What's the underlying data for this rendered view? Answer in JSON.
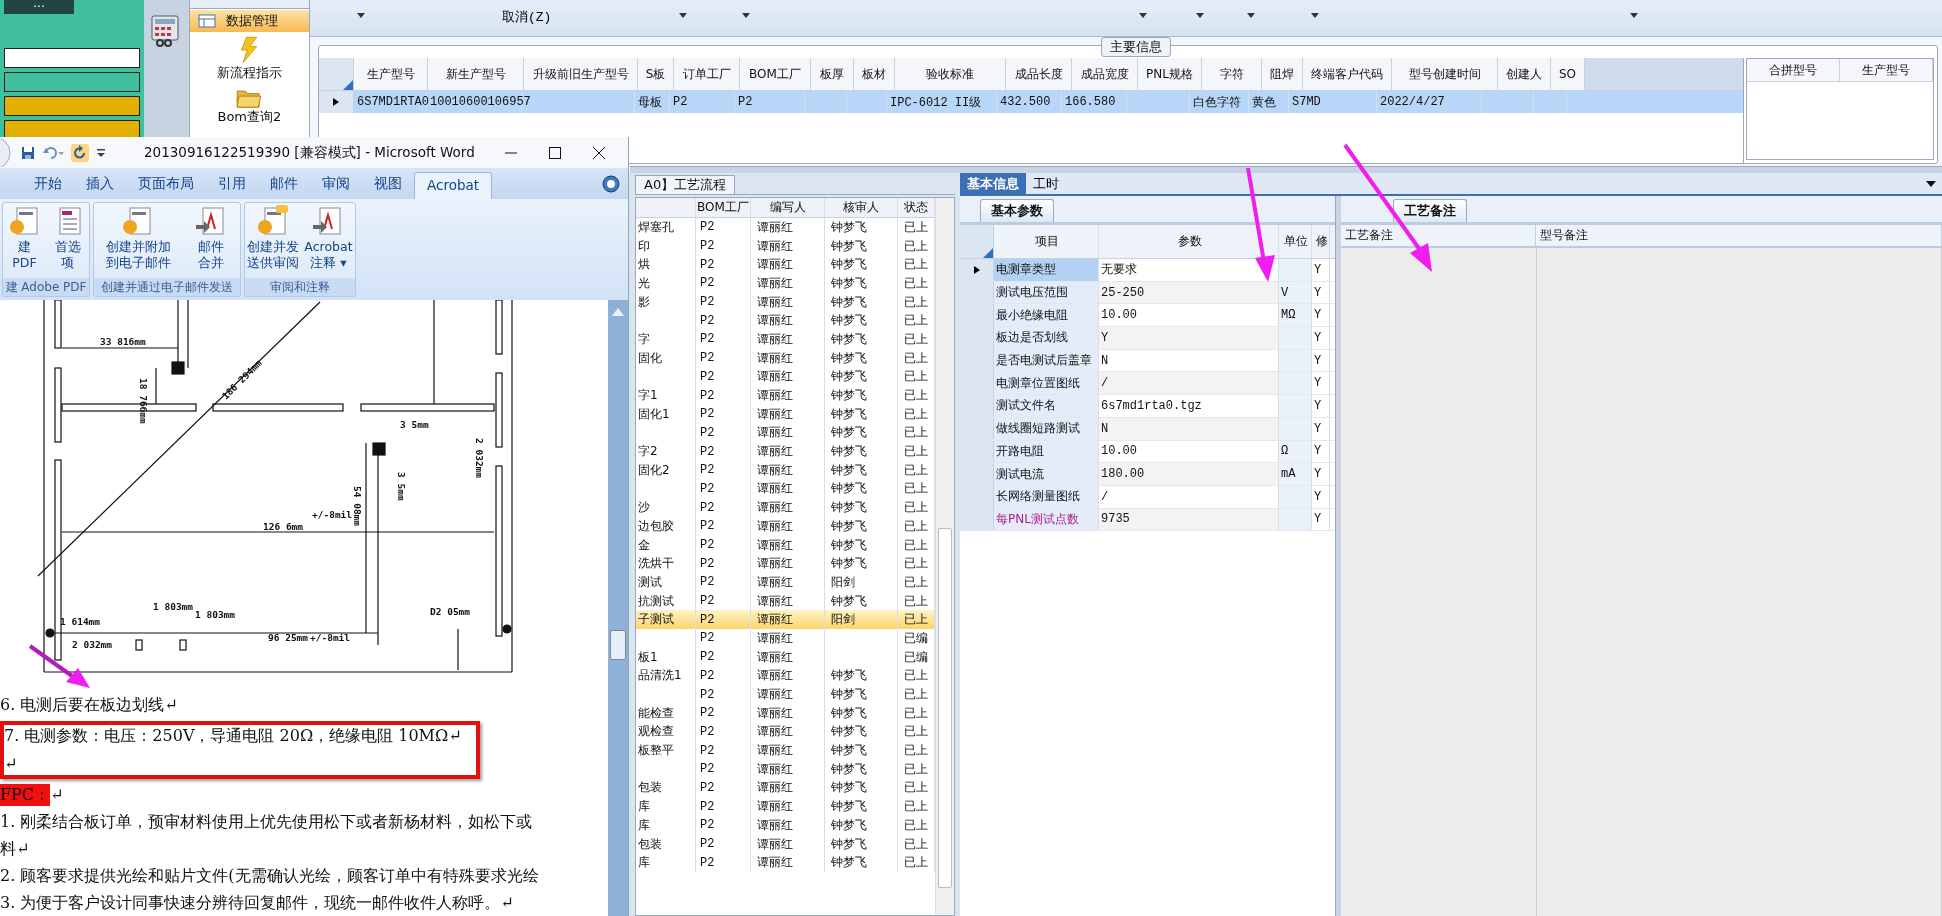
{
  "left_app": {
    "menu": "···"
  },
  "nav": {
    "items": [
      {
        "label": "数据管理",
        "selected": true
      },
      {
        "label": "新流程指示",
        "selected": false
      },
      {
        "label": "Bom查询2",
        "selected": false
      }
    ]
  },
  "toolbar": {
    "cancel": "取消(Z)"
  },
  "main_info": {
    "title": "主要信息",
    "columns": [
      "生产型号",
      "新生产型号",
      "升级前旧生产型号",
      "S板",
      "订单工厂",
      "BOM工厂",
      "板厚",
      "板材",
      "验收标准",
      "成品长度",
      "成品宽度",
      "PNL规格",
      "字符",
      "阻焊",
      "终端客户代码",
      "型号创建时间",
      "创建人",
      "SO"
    ],
    "rows": [
      {
        "selected": true,
        "cells": [
          "6S7MD1RTA0",
          "10010600106957",
          null,
          "母板",
          "P2",
          "P2",
          null,
          null,
          "IPC-6012 II级",
          "432.500",
          "166.580",
          null,
          "白色字符",
          "黄色",
          "S7MD",
          "2022/4/27",
          null,
          null
        ]
      }
    ]
  },
  "merge_grid": {
    "columns": [
      "合拼型号",
      "生产型号"
    ]
  },
  "process": {
    "tab": "A0】工艺流程",
    "columns": [
      "BOM工厂",
      "编写人",
      "核审人",
      "状态"
    ],
    "rows": [
      {
        "name": "焊塞孔",
        "factory": "P2",
        "writer": "谭丽红",
        "reviewer": "钟梦飞",
        "status": "已上",
        "selected": false
      },
      {
        "name": "印",
        "factory": "P2",
        "writer": "谭丽红",
        "reviewer": "钟梦飞",
        "status": "已上",
        "selected": false
      },
      {
        "name": "烘",
        "factory": "P2",
        "writer": "谭丽红",
        "reviewer": "钟梦飞",
        "status": "已上",
        "selected": false
      },
      {
        "name": "光",
        "factory": "P2",
        "writer": "谭丽红",
        "reviewer": "钟梦飞",
        "status": "已上",
        "selected": false
      },
      {
        "name": "影",
        "factory": "P2",
        "writer": "谭丽红",
        "reviewer": "钟梦飞",
        "status": "已上",
        "selected": false
      },
      {
        "factory": "P2",
        "writer": "谭丽红",
        "reviewer": "钟梦飞",
        "status": "已上",
        "selected": false
      },
      {
        "name": "字",
        "factory": "P2",
        "writer": "谭丽红",
        "reviewer": "钟梦飞",
        "status": "已上",
        "selected": false
      },
      {
        "name": "固化",
        "factory": "P2",
        "writer": "谭丽红",
        "reviewer": "钟梦飞",
        "status": "已上",
        "selected": false
      },
      {
        "factory": "P2",
        "writer": "谭丽红",
        "reviewer": "钟梦飞",
        "status": "已上",
        "selected": false
      },
      {
        "name": "字1",
        "factory": "P2",
        "writer": "谭丽红",
        "reviewer": "钟梦飞",
        "status": "已上",
        "selected": false
      },
      {
        "name": "固化1",
        "factory": "P2",
        "writer": "谭丽红",
        "reviewer": "钟梦飞",
        "status": "已上",
        "selected": false
      },
      {
        "factory": "P2",
        "writer": "谭丽红",
        "reviewer": "钟梦飞",
        "status": "已上",
        "selected": false
      },
      {
        "name": "字2",
        "factory": "P2",
        "writer": "谭丽红",
        "reviewer": "钟梦飞",
        "status": "已上",
        "selected": false
      },
      {
        "name": "固化2",
        "factory": "P2",
        "writer": "谭丽红",
        "reviewer": "钟梦飞",
        "status": "已上",
        "selected": false
      },
      {
        "factory": "P2",
        "writer": "谭丽红",
        "reviewer": "钟梦飞",
        "status": "已上",
        "selected": false
      },
      {
        "name": "沙",
        "factory": "P2",
        "writer": "谭丽红",
        "reviewer": "钟梦飞",
        "status": "已上",
        "selected": false
      },
      {
        "name": "边包胶",
        "factory": "P2",
        "writer": "谭丽红",
        "reviewer": "钟梦飞",
        "status": "已上",
        "selected": false
      },
      {
        "name": "金",
        "factory": "P2",
        "writer": "谭丽红",
        "reviewer": "钟梦飞",
        "status": "已上",
        "selected": false
      },
      {
        "name": "洗烘干",
        "factory": "P2",
        "writer": "谭丽红",
        "reviewer": "钟梦飞",
        "status": "已上",
        "selected": false
      },
      {
        "name": "测试",
        "factory": "P2",
        "writer": "谭丽红",
        "reviewer": "阳剑",
        "status": "已上",
        "selected": false
      },
      {
        "name": "抗测试",
        "factory": "P2",
        "writer": "谭丽红",
        "reviewer": "钟梦飞",
        "status": "已上",
        "selected": false
      },
      {
        "name": "子测试",
        "factory": "P2",
        "writer": "谭丽红",
        "reviewer": "阳剑",
        "status": "已上",
        "selected": true
      },
      {
        "factory": "P2",
        "writer": "谭丽红",
        "status": "已编",
        "selected": false
      },
      {
        "name": "板1",
        "factory": "P2",
        "writer": "谭丽红",
        "status": "已编",
        "selected": false
      },
      {
        "name": "品清洗1",
        "factory": "P2",
        "writer": "谭丽红",
        "reviewer": "钟梦飞",
        "status": "已上",
        "selected": false
      },
      {
        "factory": "P2",
        "writer": "谭丽红",
        "reviewer": "钟梦飞",
        "status": "已上",
        "selected": false
      },
      {
        "name": "能检查",
        "factory": "P2",
        "writer": "谭丽红",
        "reviewer": "钟梦飞",
        "status": "已上",
        "selected": false
      },
      {
        "name": "观检查",
        "factory": "P2",
        "writer": "谭丽红",
        "reviewer": "钟梦飞",
        "status": "已上",
        "selected": false
      },
      {
        "name": "板整平",
        "factory": "P2",
        "writer": "谭丽红",
        "reviewer": "钟梦飞",
        "status": "已上",
        "selected": false
      },
      {
        "factory": "P2",
        "writer": "谭丽红",
        "reviewer": "钟梦飞",
        "status": "已上",
        "selected": false
      },
      {
        "name": "包装",
        "factory": "P2",
        "writer": "谭丽红",
        "reviewer": "钟梦飞",
        "status": "已上",
        "selected": false
      },
      {
        "name": "库",
        "factory": "P2",
        "writer": "谭丽红",
        "reviewer": "钟梦飞",
        "status": "已上",
        "selected": false
      },
      {
        "name": "库",
        "factory": "P2",
        "writer": "谭丽红",
        "reviewer": "钟梦飞",
        "status": "已上",
        "selected": false
      },
      {
        "name": "包装",
        "factory": "P2",
        "writer": "谭丽红",
        "reviewer": "钟梦飞",
        "status": "已上",
        "selected": false
      },
      {
        "name": "库",
        "factory": "P2",
        "writer": "谭丽红",
        "reviewer": "钟梦飞",
        "status": "已上",
        "selected": false
      }
    ]
  },
  "detail_tabs": [
    {
      "label": "基本信息",
      "selected": true
    },
    {
      "label": "工时",
      "selected": false
    }
  ],
  "params": {
    "tab": "基本参数",
    "columns": [
      "项目",
      "参数",
      "单位",
      "修"
    ],
    "rows": [
      {
        "item": "电测章类型",
        "value": "无要求",
        "flag": "Y",
        "selected": true,
        "emphasized": false
      },
      {
        "item": "测试电压范围",
        "value": "25-250",
        "unit": "V",
        "flag": "Y",
        "selected": false,
        "emphasized": false
      },
      {
        "item": "最小绝缘电阻",
        "value": "10.00",
        "unit": "MΩ",
        "flag": "Y",
        "selected": false,
        "emphasized": false
      },
      {
        "item": "板边是否划线",
        "value": "Y",
        "flag": "Y",
        "selected": false,
        "emphasized": false
      },
      {
        "item": "是否电测试后盖章",
        "value": "N",
        "flag": "Y",
        "selected": false,
        "emphasized": false
      },
      {
        "item": "电测章位置图纸",
        "value": "/",
        "flag": "Y",
        "selected": false,
        "emphasized": false
      },
      {
        "item": "测试文件名",
        "value": "6s7md1rta0.tgz",
        "flag": "Y",
        "selected": false,
        "emphasized": false
      },
      {
        "item": "做线圈短路测试",
        "value": "N",
        "flag": "Y",
        "selected": false,
        "emphasized": false
      },
      {
        "item": "开路电阻",
        "value": "10.00",
        "unit": "Ω",
        "flag": "Y",
        "selected": false,
        "emphasized": false
      },
      {
        "item": "测试电流",
        "value": "180.00",
        "unit": "mA",
        "flag": "Y",
        "selected": false,
        "emphasized": false
      },
      {
        "item": "长网络测量图纸",
        "value": "/",
        "flag": "Y",
        "selected": false,
        "emphasized": false
      },
      {
        "item": "每PNL测试点数",
        "value": "9735",
        "flag": "Y",
        "selected": false,
        "emphasized": true
      }
    ]
  },
  "remarks": {
    "tab": "工艺备注",
    "columns": [
      "工艺备注",
      "型号备注"
    ]
  },
  "word": {
    "title": "20130916122519390 [兼容模式] - Microsoft Word",
    "tabs": [
      {
        "label": "开始",
        "selected": false
      },
      {
        "label": "插入",
        "selected": false
      },
      {
        "label": "页面布局",
        "selected": false
      },
      {
        "label": "引用",
        "selected": false
      },
      {
        "label": "邮件",
        "selected": false
      },
      {
        "label": "审阅",
        "selected": false
      },
      {
        "label": "视图",
        "selected": false
      },
      {
        "label": "Acrobat",
        "selected": true
      }
    ],
    "groups": [
      {
        "caption": "建 Adobe PDF",
        "buttons": [
          [
            "建",
            "PDF"
          ],
          [
            "首选",
            "项"
          ]
        ]
      },
      {
        "caption": "创建并通过电子邮件发送",
        "buttons": [
          [
            "创建并附加",
            "到电子邮件"
          ],
          [
            "邮件",
            "合并"
          ]
        ]
      },
      {
        "caption": "审阅和注释",
        "buttons": [
          [
            "创建并发",
            "送供审阅"
          ],
          [
            "Acrobat",
            "注释 ▾"
          ]
        ]
      }
    ],
    "drawing_labels": [
      "33 816mm",
      "18 766mm",
      "186 294mm",
      "3 5mm",
      "2 032mm",
      "54 08mm",
      "+/-8mil",
      "3 5mm",
      "126 6mm",
      "1 803mm",
      "1 803mm",
      "1 614mm",
      "2 032mm",
      "96 25mm",
      "+/-8mil",
      "D2 05mm"
    ],
    "paragraphs": [
      {
        "kind": "plain",
        "text": "6.    电测后要在板边划线↵"
      },
      {
        "kind": "boxed",
        "text": "7.    电测参数：电压：250V，导通电阻 20Ω，绝缘电阻 10MΩ↵"
      },
      {
        "kind": "boxed",
        "text": "↵"
      },
      {
        "kind": "highlight",
        "text": "FPC：",
        "mark": "↵"
      },
      {
        "kind": "plain",
        "text": "1.  刚柔结合板订单，预审材料使用上优先使用松下或者新杨材料，如松下或"
      },
      {
        "kind": "plain",
        "text": "料↵"
      },
      {
        "kind": "plain",
        "text": "2.  顾客要求提供光绘和贴片文件(无需确认光绘，顾客订单中有特殊要求光绘"
      },
      {
        "kind": "plain",
        "text": "3. 为便于客户设计同事快速分辨待回复邮件，现统一邮件收件人称呼。↵"
      }
    ]
  }
}
